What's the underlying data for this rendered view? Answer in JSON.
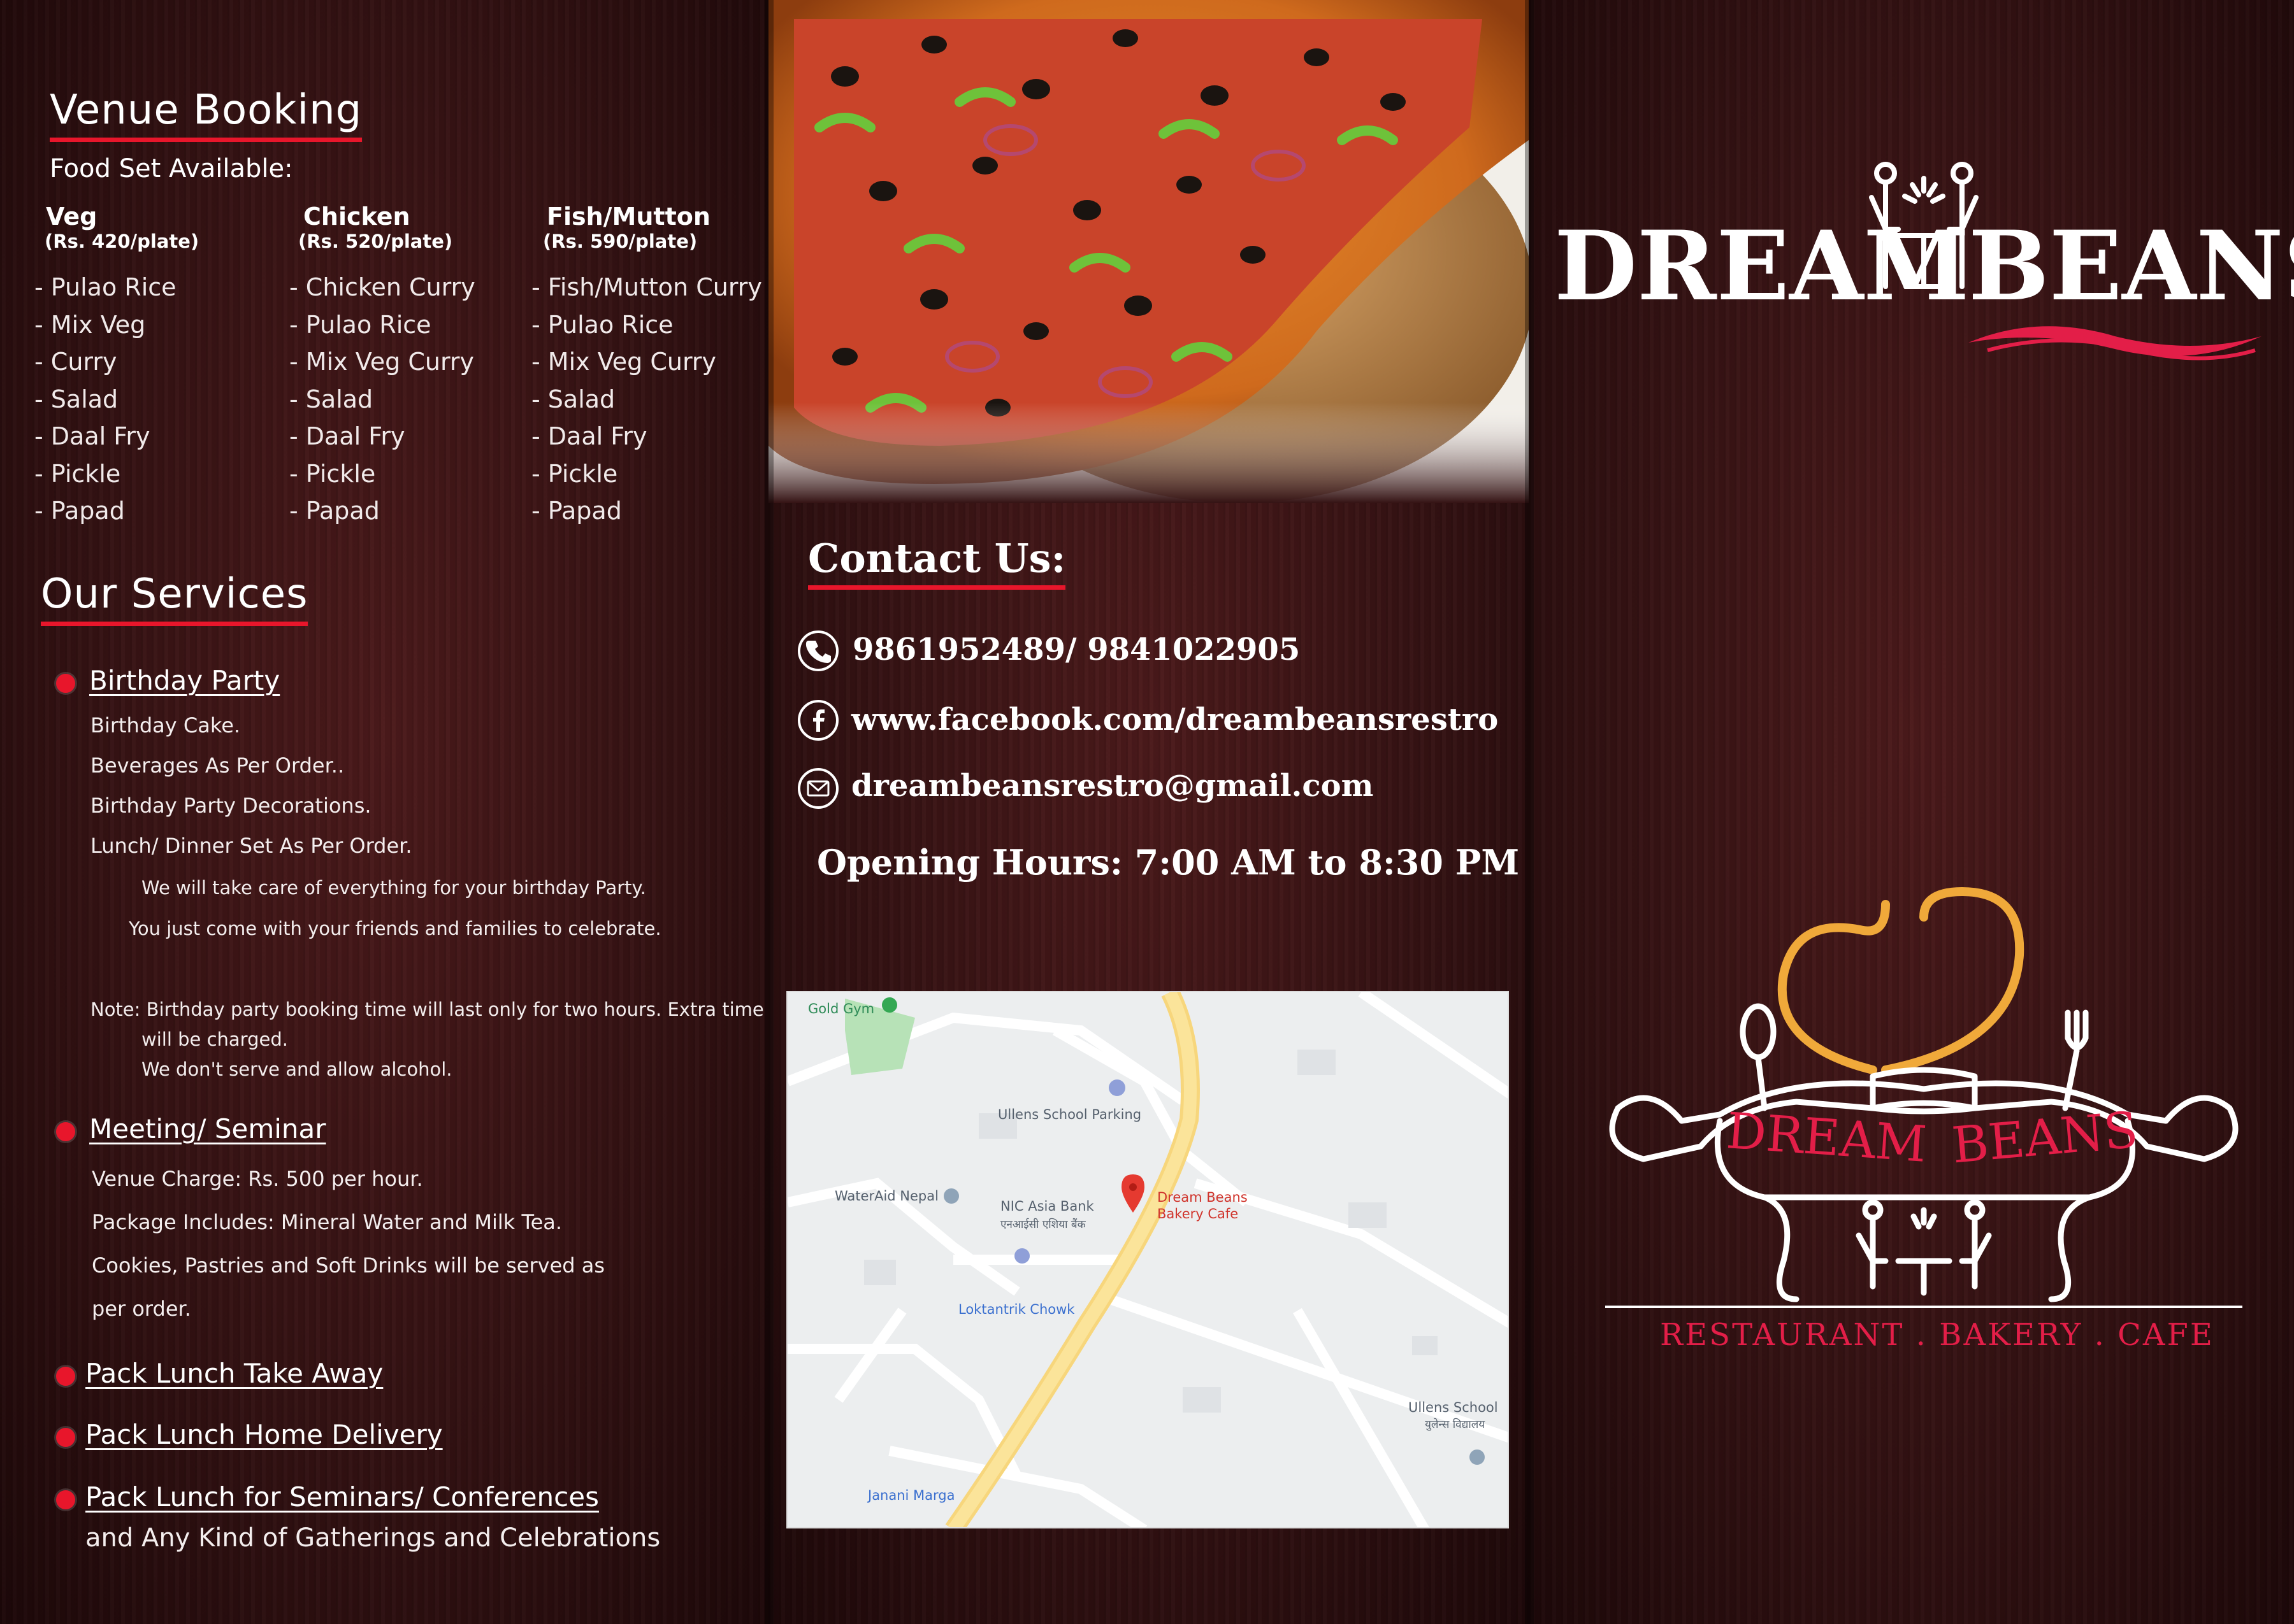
{
  "venue": {
    "heading": "Venue Booking",
    "subheading": "Food Set Available:",
    "sets": [
      {
        "title": "Veg",
        "price": "(Rs. 420/plate)",
        "items": [
          "- Pulao Rice",
          "- Mix Veg",
          "- Curry",
          "- Salad",
          "- Daal Fry",
          "- Pickle",
          "- Papad"
        ]
      },
      {
        "title": "Chicken",
        "price": "(Rs. 520/plate)",
        "items": [
          "- Chicken Curry",
          "- Pulao Rice",
          "- Mix Veg Curry",
          "- Salad",
          "- Daal Fry",
          "- Pickle",
          "- Papad"
        ]
      },
      {
        "title": "Fish/Mutton",
        "price": "(Rs. 590/plate)",
        "items": [
          "- Fish/Mutton Curry",
          "- Pulao Rice",
          "- Mix Veg Curry",
          "- Salad",
          "- Daal Fry",
          "- Pickle",
          "- Papad"
        ]
      }
    ]
  },
  "services": {
    "heading": "Our Services",
    "birthday": {
      "title": "Birthday Party",
      "lines": [
        "Birthday Cake.",
        "Beverages As Per Order..",
        "Birthday Party Decorations.",
        "Lunch/ Dinner Set As Per Order."
      ],
      "message1": "We will take care of everything for your birthday Party.",
      "message2": "You just come with your friends and families to celebrate.",
      "note1": "Note: Birthday party booking time will last only for two hours. Extra time",
      "note2": "will be charged.",
      "note3": "We don't serve and allow alcohol."
    },
    "meeting": {
      "title": "Meeting/ Seminar",
      "lines": [
        "Venue Charge: Rs. 500 per hour.",
        "Package Includes: Mineral Water and Milk Tea.",
        "Cookies, Pastries and Soft Drinks will be served as",
        "per order."
      ]
    },
    "takeaway": "Pack Lunch Take Away",
    "delivery": "Pack Lunch Home Delivery",
    "seminars": "Pack Lunch for Seminars/ Conferences",
    "gatherings": "and Any Kind of Gatherings and Celebrations"
  },
  "contact": {
    "heading": "Contact Us:",
    "phone": "9861952489/ 9841022905",
    "facebook": "www.facebook.com/dreambeansrestro",
    "email": "dreambeansrestro@gmail.com",
    "hours": "Opening Hours: 7:00 AM to 8:30 PM"
  },
  "map": {
    "labels": {
      "gold_gym": "Gold Gym",
      "ullens_parking": "Ullens School Parking",
      "wateraid": "WaterAid Nepal",
      "nic_bank": "NIC Asia Bank",
      "nic_bank_ne": "एनआईसी एशिया बैंक",
      "dream_beans_1": "Dream Beans",
      "dream_beans_2": "Bakery Cafe",
      "loktantrik": "Loktantrik Chowk",
      "ullens_school": "Ullens School",
      "ullens_school_ne": "युलेन्स विद्यालय",
      "janani": "Janani Marga"
    }
  },
  "brand": {
    "logo_left": "DREAM",
    "logo_right": "BEANS",
    "emblem_left": "DREAM",
    "emblem_right": "BEANS",
    "tagline": "RESTAURANT . BAKERY . CAFE"
  },
  "colors": {
    "accent_red": "#e8162b",
    "brand_pink": "#e31e48",
    "heart_orange": "#f0a93a"
  }
}
